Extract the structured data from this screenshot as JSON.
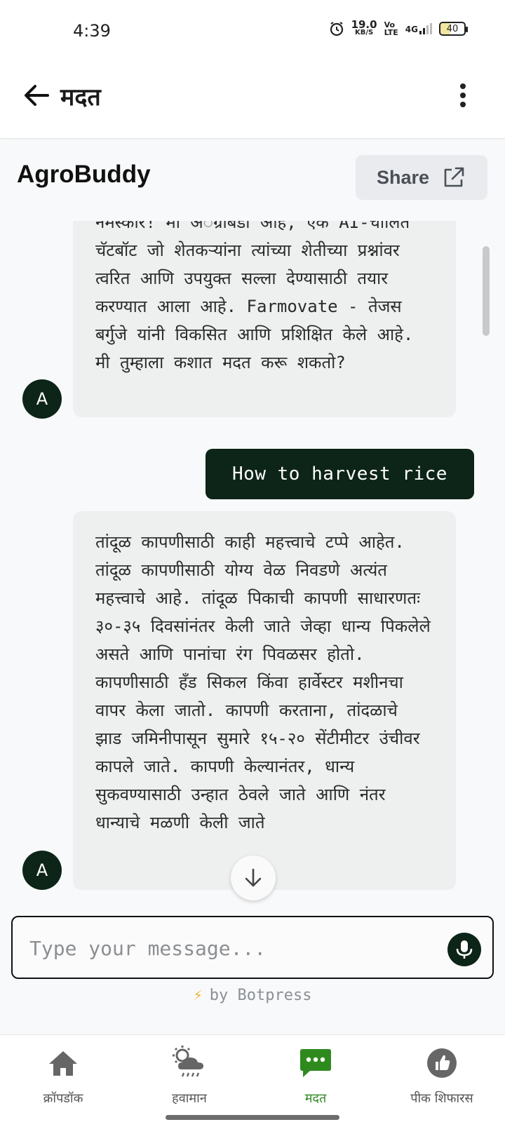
{
  "status_bar": {
    "time": "4:39",
    "speed_value": "19.0",
    "speed_unit": "KB/S",
    "volte_top": "Vo",
    "volte_bottom": "LTE",
    "network": "4G",
    "battery": "40"
  },
  "app_bar": {
    "title": "मदत",
    "back_icon": "arrow-left-icon",
    "menu_icon": "more-vert-icon"
  },
  "chat": {
    "bot_name": "AgroBuddy",
    "share_label": "Share",
    "avatar_letter": "A",
    "messages": [
      {
        "from": "bot",
        "text": "नमस्कार! मी अॅग्रोबडी आहे, एक AI-चालित चॅटबॉट जो शेतकऱ्यांना त्यांच्या शेतीच्या प्रश्नांवर त्वरित आणि उपयुक्त सल्ला देण्यासाठी तयार करण्यात आला आहे. Farmovate - तेजस बर्गुजे यांनी विकसित आणि प्रशिक्षित केले आहे. मी तुम्हाला कशात मदत करू शकतो?"
      },
      {
        "from": "user",
        "text": "How to harvest rice"
      },
      {
        "from": "bot",
        "text": "तांदूळ कापणीसाठी काही महत्त्वाचे टप्पे आहेत. तांदूळ कापणीसाठी योग्य वेळ निवडणे अत्यंत महत्त्वाचे आहे. तांदूळ पिकाची कापणी साधारणतः ३०-३५ दिवसांनंतर केली जाते जेव्हा धान्य पिकलेले असते आणि पानांचा रंग पिवळसर होतो. कापणीसाठी हँड सिकल किंवा हार्वेस्टर मशीनचा वापर केला जातो. कापणी करताना, तांदळाचे झाड जमिनीपासून सुमारे १५-२० सेंटीमीटर उंचीवर कापले जाते. कापणी केल्यानंतर, धान्य सुकवण्यासाठी उन्हात ठेवले जाते आणि नंतर धान्याचे मळणी केली जाते"
      }
    ],
    "input_placeholder": "Type your message...",
    "powered_by": "by Botpress"
  },
  "bottom_nav": {
    "items": [
      {
        "label": "क्रॉपडॉक",
        "icon": "home-icon",
        "active": false
      },
      {
        "label": "हवामान",
        "icon": "weather-icon",
        "active": false
      },
      {
        "label": "मदत",
        "icon": "chat-icon",
        "active": true
      },
      {
        "label": "पीक शिफारस",
        "icon": "thumbs-up-icon",
        "active": false
      }
    ]
  },
  "colors": {
    "accent_dark_green": "#0d2418",
    "active_nav_green": "#2f8a1e",
    "bubble_bot_bg": "#eef0f0"
  }
}
